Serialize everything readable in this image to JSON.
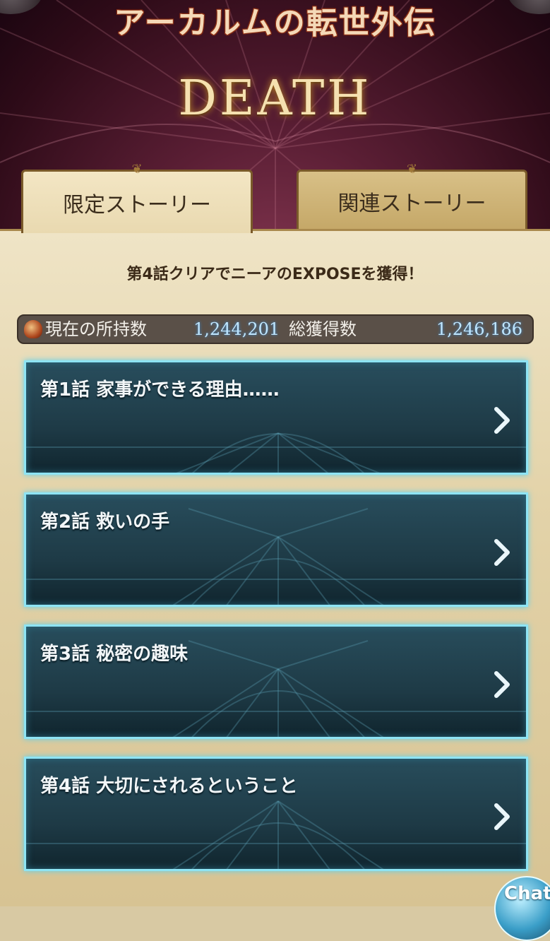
{
  "header": {
    "title": "アーカルムの転世外伝",
    "logo_text": "DEATH"
  },
  "tabs": [
    {
      "label": "限定ストーリー",
      "active": true
    },
    {
      "label": "関連ストーリー",
      "active": false
    }
  ],
  "info": {
    "reward_text": "第4話クリアでニーアのEXPOSEを獲得！"
  },
  "counts": {
    "icon": "gem-icon",
    "current_label": "現在の所持数",
    "current_value": "1,244,201",
    "total_label": "総獲得数",
    "total_value": "1,246,186"
  },
  "episodes": [
    {
      "title": "第1話 家事ができる理由……",
      "icon": "chevron-right-icon"
    },
    {
      "title": "第2話 救いの手",
      "icon": "chevron-right-icon"
    },
    {
      "title": "第3話 秘密の趣味",
      "icon": "chevron-right-icon"
    },
    {
      "title": "第4話 大切にされるということ",
      "icon": "chevron-right-icon"
    }
  ],
  "chat": {
    "label": "Chat"
  },
  "colors": {
    "header_bg": "#5a1e34",
    "panel_bg": "#e3d3a9",
    "episode_border": "#8ee4f4",
    "count_value": "#bfe6ff"
  }
}
